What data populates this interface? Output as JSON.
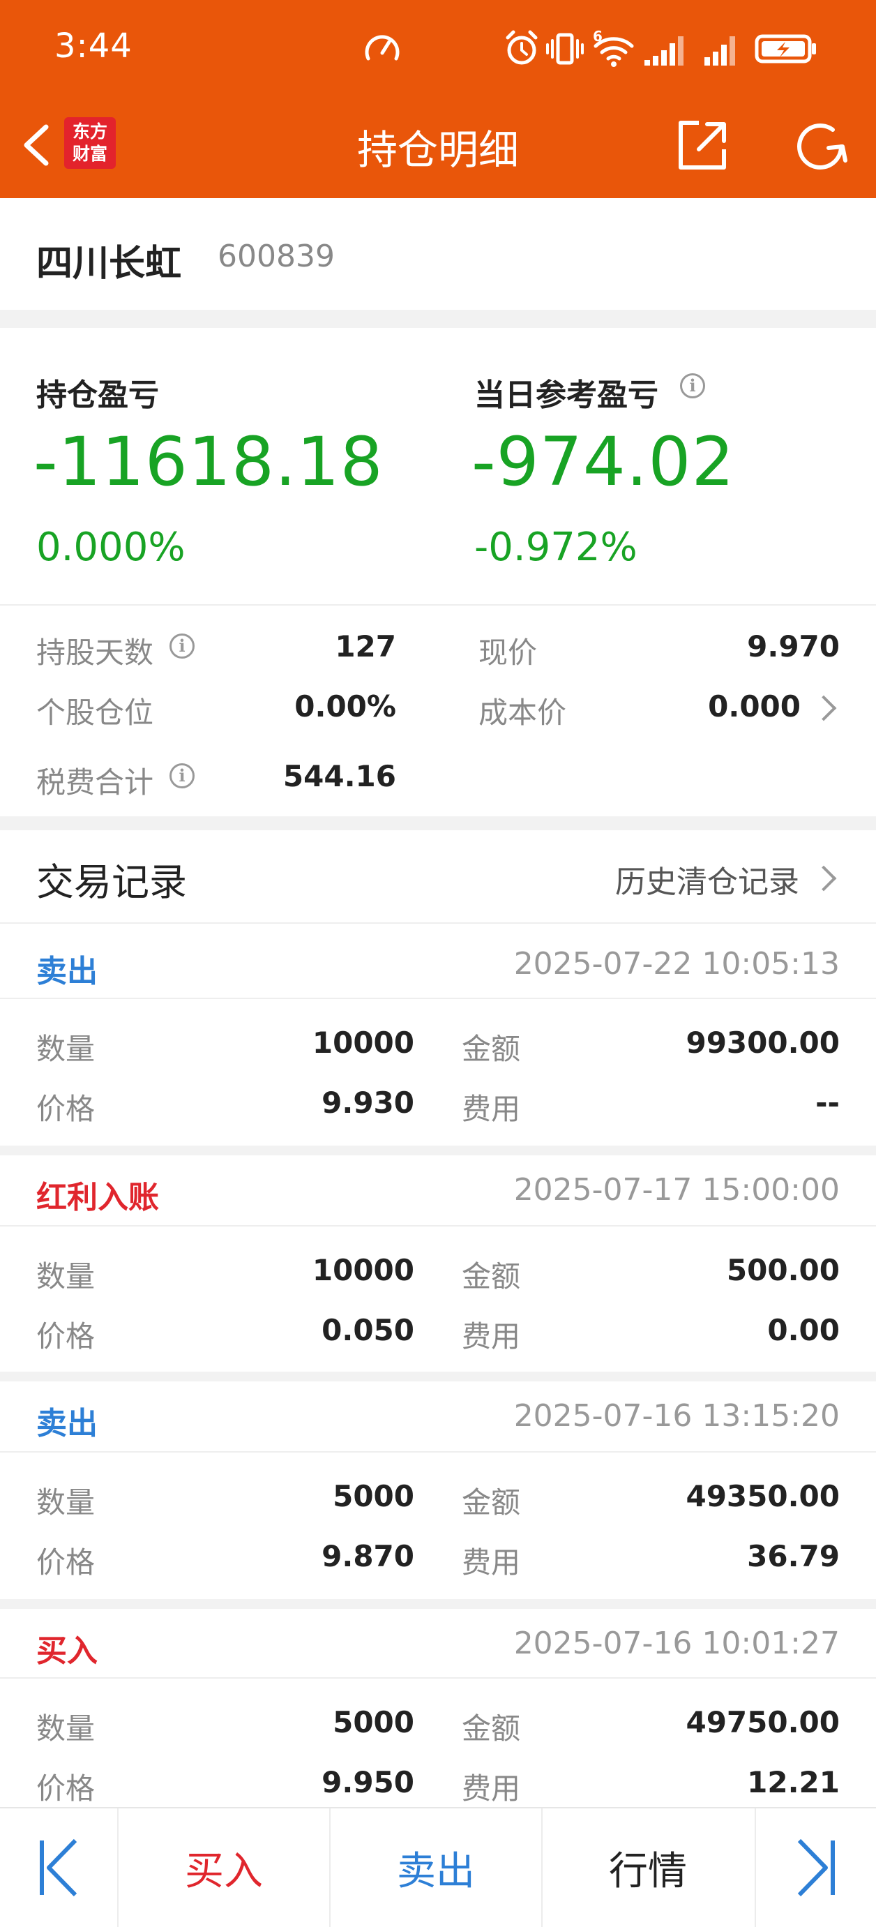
{
  "status_bar": {
    "time": "3:44",
    "network_label": "6"
  },
  "nav": {
    "title": "持仓明细",
    "logo_line1": "东方",
    "logo_line2": "财富"
  },
  "stock": {
    "name": "四川长虹",
    "code": "600839"
  },
  "summary": {
    "position_pl_label": "持仓盈亏",
    "position_pl_value": "-11618.18",
    "position_pl_pct": "0.000%",
    "daily_pl_label": "当日参考盈亏",
    "daily_pl_value": "-974.02",
    "daily_pl_pct": "-0.972%"
  },
  "details": {
    "hold_days_label": "持股天数",
    "hold_days_value": "127",
    "current_price_label": "现价",
    "current_price_value": "9.970",
    "position_ratio_label": "个股仓位",
    "position_ratio_value": "0.00%",
    "cost_price_label": "成本价",
    "cost_price_value": "0.000",
    "fees_total_label": "税费合计",
    "fees_total_value": "544.16"
  },
  "records_section": {
    "title": "交易记录",
    "history_link": "历史清仓记录"
  },
  "field_labels": {
    "qty": "数量",
    "amount": "金额",
    "price": "价格",
    "fee": "费用"
  },
  "records": [
    {
      "type": "卖出",
      "datetime": "2025-07-22 10:05:13",
      "qty": "10000",
      "amount": "99300.00",
      "price": "9.930",
      "fee": "--"
    },
    {
      "type": "红利入账",
      "datetime": "2025-07-17 15:00:00",
      "qty": "10000",
      "amount": "500.00",
      "price": "0.050",
      "fee": "0.00"
    },
    {
      "type": "卖出",
      "datetime": "2025-07-16 13:15:20",
      "qty": "5000",
      "amount": "49350.00",
      "price": "9.870",
      "fee": "36.79"
    },
    {
      "type": "买入",
      "datetime": "2025-07-16 10:01:27",
      "qty": "5000",
      "amount": "49750.00",
      "price": "9.950",
      "fee": "12.21"
    }
  ],
  "bottom_bar": {
    "buy": "买入",
    "sell": "卖出",
    "quote": "行情"
  },
  "colors": {
    "brand_orange": "#e9560a",
    "gain_green": "#18a324",
    "sell_blue": "#2d7fd6",
    "buy_red": "#e0262d"
  }
}
